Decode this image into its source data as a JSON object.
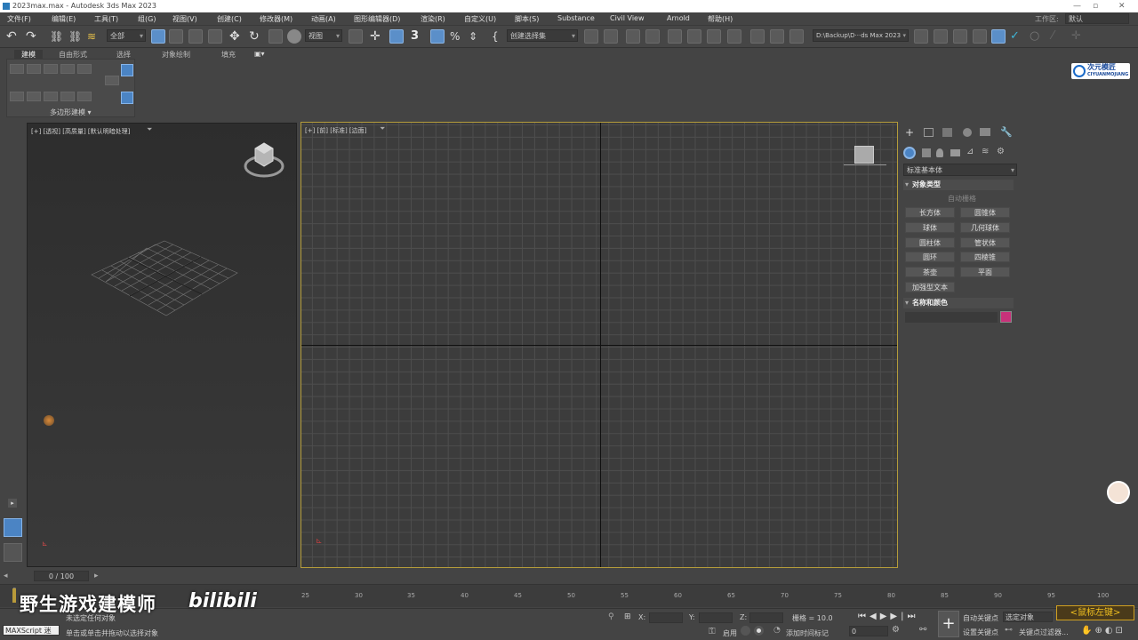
{
  "window": {
    "title": "2023max.max - Autodesk 3ds Max 2023"
  },
  "menu": {
    "items": [
      "文件(F)",
      "编辑(E)",
      "工具(T)",
      "组(G)",
      "视图(V)",
      "创建(C)",
      "修改器(M)",
      "动画(A)",
      "图形编辑器(D)",
      "渲染(R)",
      "自定义(U)",
      "脚本(S)",
      "Substance",
      "Civil View",
      "Arnold",
      "帮助(H)"
    ],
    "workspace_label": "工作区:",
    "workspace_value": "默认"
  },
  "toolbar": {
    "selection_filter": "全部",
    "ref_coord": "视图",
    "named_selection": "创建选择集",
    "path": "D:\\Backup\\D···ds Max 2023"
  },
  "ribbon": {
    "tabs": [
      "建模",
      "自由形式",
      "选择",
      "对象绘制",
      "填充"
    ],
    "panel_label": "多边形建模 ▾"
  },
  "logo": {
    "line1": "次元模匠",
    "line2": "CIYUANMOJIANG"
  },
  "viewports": {
    "left_label": "[+] [透视] [高质量] [默认明暗处理]",
    "main_label": "[+] [前] [标准] [边面]"
  },
  "command_panel": {
    "category": "标准基本体",
    "rollout_object_type": "对象类型",
    "autogrid": "自动栅格",
    "buttons": [
      "长方体",
      "圆锥体",
      "球体",
      "几何球体",
      "圆柱体",
      "管状体",
      "圆环",
      "四棱锥",
      "茶壶",
      "平面",
      "加强型文本"
    ],
    "rollout_name_color": "名称和颜色",
    "object_color": "#c8327a"
  },
  "timeline": {
    "frame_counter": "0 / 100",
    "ticks": [
      "25",
      "30",
      "35",
      "40",
      "45",
      "50",
      "55",
      "60",
      "65",
      "70",
      "75",
      "80",
      "85",
      "90",
      "95",
      "100"
    ]
  },
  "status": {
    "maxscript_label": "MAXScript 迷",
    "line1": "未选定任何对象",
    "line2": "单击或单击并拖动以选择对象",
    "x_label": "X:",
    "y_label": "Y:",
    "z_label": "Z:",
    "grid": "栅格 = 10.0",
    "enable": "启用",
    "add_time_tag": "添加时间标记",
    "auto_key": "自动关键点",
    "set_key": "设置关键点",
    "selected_objects": "选定对象",
    "key_filters": "关键点过滤器...",
    "frame_value": "0"
  },
  "watermark": {
    "channel": "野生游戏建模师",
    "site": "bilibili"
  },
  "key_badge": "<鼠标左键>"
}
